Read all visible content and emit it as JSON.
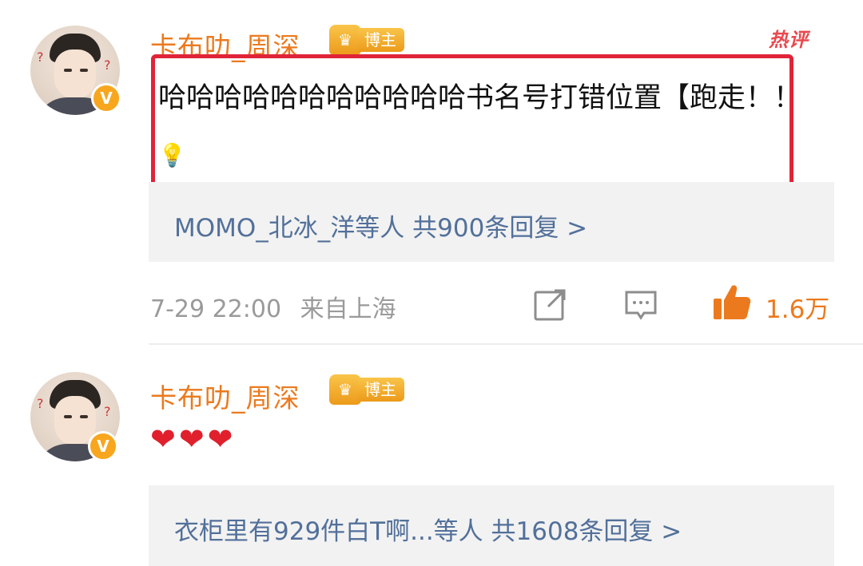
{
  "comments": [
    {
      "username": "卡布叻_周深",
      "badge_label": "博主",
      "hot_tag": "热评",
      "text": "哈哈哈哈哈哈哈哈哈哈哈书名号打错位置【跑走！！",
      "reply_summary": "MOMO_北冰_洋等人  共900条回复 >",
      "timestamp": "7-29 22:00",
      "location": "来自上海",
      "likes": "1.6万"
    },
    {
      "username": "卡布叻_周深",
      "badge_label": "博主",
      "text": "❤❤❤",
      "reply_summary": "衣柜里有929件白T啊...等人  共1608条回复 >"
    }
  ],
  "colors": {
    "username": "#eb7a1e",
    "link": "#52709a",
    "highlight": "#e02438",
    "hot": "#e9484d"
  },
  "icons": [
    "crown-icon",
    "verified-v-icon",
    "lightbulb-icon",
    "share-icon",
    "comment-icon",
    "like-thumb-icon",
    "chevron-right-icon"
  ]
}
